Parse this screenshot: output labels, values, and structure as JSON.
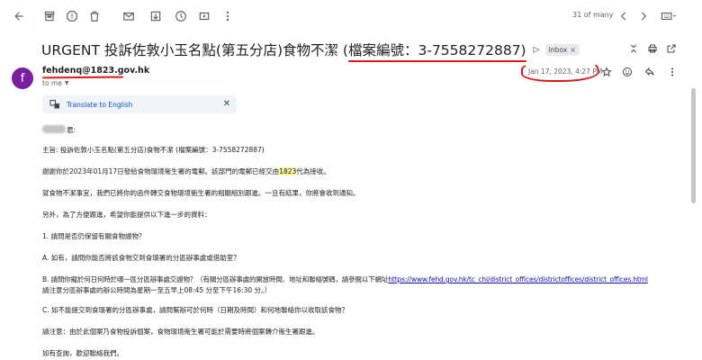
{
  "toolbar": {
    "icons": [
      "back-arrow-icon",
      "archive-icon",
      "report-spam-icon",
      "delete-icon",
      "mark-unread-icon",
      "snooze-icon",
      "add-task-icon",
      "move-to-icon",
      "more-vert-icon"
    ],
    "paging": "31 of many"
  },
  "email": {
    "subject_pre": "URGENT 投訴佐敦小玉名點(第五分店)食物不潔 (",
    "subject_hl": "檔案編號：3-7558272887)",
    "label": "Inbox",
    "label_remove": "×",
    "sender": "fehdenq@1823.gov.hk",
    "avatar_letter": "f",
    "to": "to me",
    "date": "Jan 17, 2023, 4:27 PM"
  },
  "translate": {
    "link": "Translate to English",
    "close": "✕"
  },
  "body": {
    "greeting_suffix": "君:",
    "l1": "主旨: 投訴佐敦小玉名點(第五分店)食物不潔 (檔案編號：3-7558272887)",
    "l2a": "謝謝你於2023年01月17日發給食物環境衞生署的電郵。該部門的電郵已經交由",
    "l2b": "1823",
    "l2c": "代為接收。",
    "l3": "就食物不潔事宜，我們已將你的函件轉交食物環境衞生署的相關組別跟進。一旦有結果，你將會收到通知。",
    "l4": "另外，為了方便跟進，希望你能提供以下進一步的資料：",
    "l5": "1. 請問是否仍保留有關食物證物？",
    "l6": "A. 如有，請問你能否將該食物交到食環署的分區辦事處或借助室？",
    "l7a": "B. 請問你擬於何日何時於哪一區分區辦事處交證物？（有關分區辦事處的開放時間、地址和聯絡號碼，請參閱以下網址",
    "l7link": "https://www.fehd.gov.hk/tc_chi/district_offices/districtoffices/district_offices.html",
    "l8": "請注意分區辦事處的辦公時間為星期一至五早上08:45 分至下午16:30 分。）",
    "l9": "C. 如不能提交到食環署的分區辦事處，請問幫辦可於何時（日期及時間）和何地聯絡你以收取該食物？",
    "l10": "請注意：由於此個案乃食物投訴個案，食物環境衞生署可能於需要時將個案轉介衞生署跟進。",
    "l11": "如有查詢，歡迎聯絡我們。"
  },
  "colors": {
    "annotation": "#e01818",
    "avatar": "#7b1fa2",
    "highlight": "#fff59d",
    "link": "#1a0dab"
  }
}
